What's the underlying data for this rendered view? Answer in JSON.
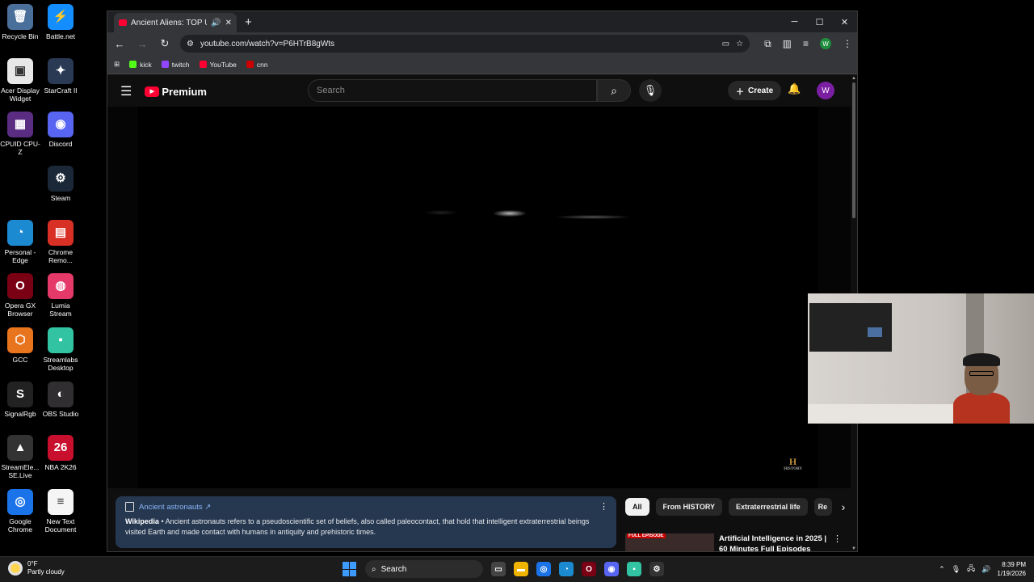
{
  "desktop": {
    "icons": [
      {
        "label": "Recycle Bin",
        "glyph": "🗑",
        "color": "#4a6f9a"
      },
      {
        "label": "Battle.net",
        "glyph": "⚡",
        "color": "#148eff"
      },
      {
        "label": "Acer Display Widget",
        "glyph": "▣",
        "color": "#e8e8e8"
      },
      {
        "label": "StarCraft II",
        "glyph": "✦",
        "color": "#2a3a55"
      },
      {
        "label": "CPUID CPU-Z",
        "glyph": "▦",
        "color": "#5a2d82"
      },
      {
        "label": "Discord",
        "glyph": "◉",
        "color": "#5865f2"
      },
      {
        "label": "Steam",
        "glyph": "⚙",
        "color": "#1b2838"
      },
      {
        "label": "Personal - Edge",
        "glyph": "◔",
        "color": "#1c8ad1"
      },
      {
        "label": "Chrome Remo...",
        "glyph": "▤",
        "color": "#d93025"
      },
      {
        "label": "Opera GX Browser",
        "glyph": "O",
        "color": "#7a0014"
      },
      {
        "label": "Lumia Stream",
        "glyph": "◍",
        "color": "#e5396a"
      },
      {
        "label": "GCC",
        "glyph": "⬡",
        "color": "#e8741e"
      },
      {
        "label": "Streamlabs Desktop",
        "glyph": "▪",
        "color": "#31c3a2"
      },
      {
        "label": "SignalRgb",
        "glyph": "S",
        "color": "#222"
      },
      {
        "label": "OBS Studio",
        "glyph": "◐",
        "color": "#302e31"
      },
      {
        "label": "StreamEle... SE.Live",
        "glyph": "▲",
        "color": "#333"
      },
      {
        "label": "NBA 2K26",
        "glyph": "26",
        "color": "#c8102e"
      },
      {
        "label": "Google Chrome",
        "glyph": "◎",
        "color": "#1a73e8"
      },
      {
        "label": "New Text Document",
        "glyph": "≡",
        "color": "#f5f5f5"
      }
    ]
  },
  "browser": {
    "tab_title": "Ancient Aliens: TOP UFO M",
    "new_tab": "+",
    "url": "youtube.com/watch?v=P6HTrB8gWts",
    "profile_initial": "W",
    "bookmarks": [
      {
        "label": "kick",
        "color": "#53fc18"
      },
      {
        "label": "twitch",
        "color": "#9146ff"
      },
      {
        "label": "YouTube",
        "color": "#ff0033"
      },
      {
        "label": "cnn",
        "color": "#cc0000"
      }
    ]
  },
  "youtube": {
    "logo_text": "Premium",
    "search_placeholder": "Search",
    "create_label": "Create",
    "avatar_initial": "W",
    "watermark": "H",
    "watermark_sub": "HISTORY",
    "info_panel": {
      "title": "Ancient astronauts ↗",
      "source": "Wikipedia",
      "text": " • Ancient astronauts refers to a pseudoscientific set of beliefs, also called paleocontact, that hold that intelligent extraterrestrial beings visited Earth and made contact with humans in antiquity and prehistoric times."
    },
    "chips": [
      "All",
      "From HISTORY",
      "Extraterrestrial life",
      "Re"
    ],
    "recommendation": {
      "badge": "FULL EPISODE",
      "title": "Artificial Intelligence in 2025 | 60 Minutes Full Episodes"
    }
  },
  "taskbar": {
    "weather_temp": "0°F",
    "weather_desc": "Partly cloudy",
    "search_label": "Search",
    "time": "8:39 PM",
    "date": "1/19/2026"
  }
}
